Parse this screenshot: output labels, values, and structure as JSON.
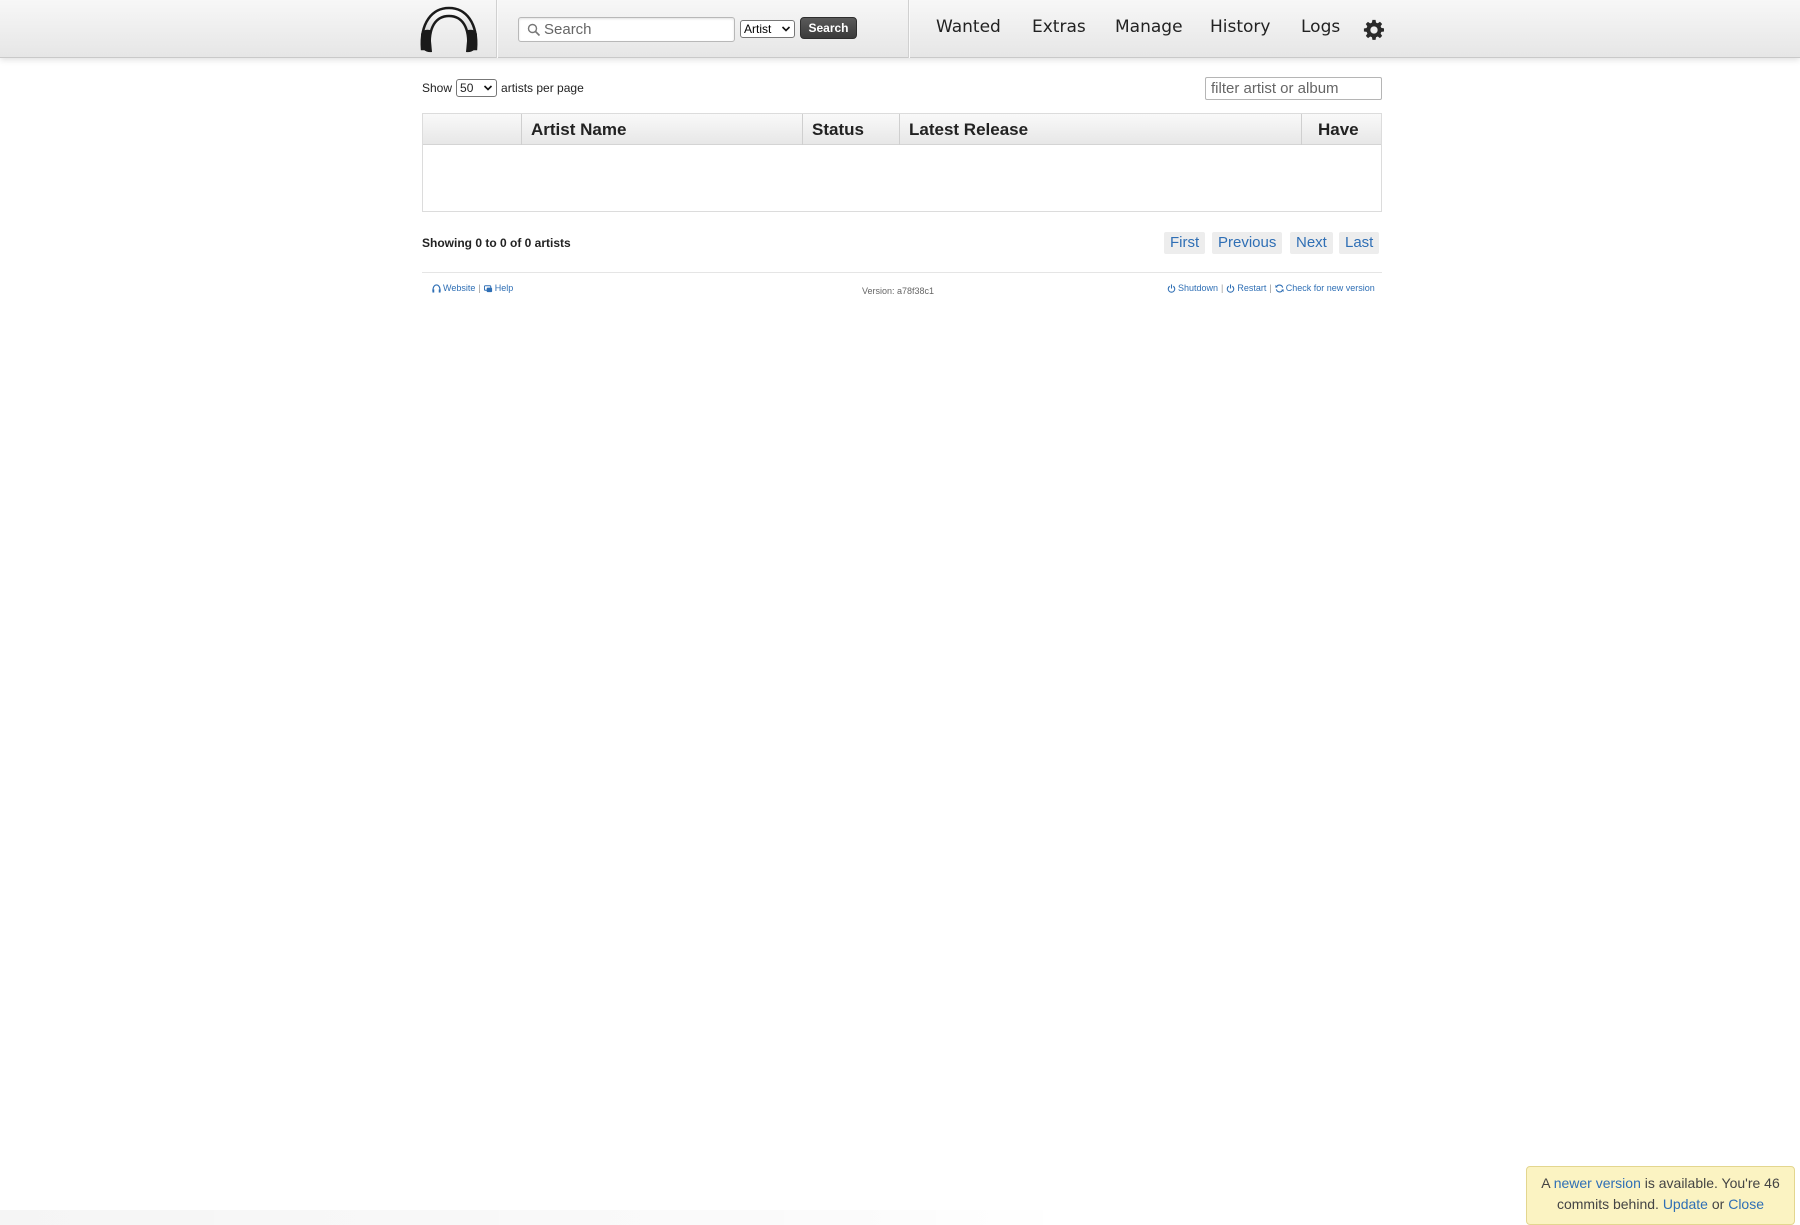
{
  "header": {
    "search": {
      "placeholder": "Search",
      "value": ""
    },
    "search_type": {
      "selected": "Artist"
    },
    "search_button_label": "Search",
    "nav": [
      "Wanted",
      "Extras",
      "Manage",
      "History",
      "Logs"
    ]
  },
  "controls": {
    "show_label": "Show",
    "per_page_value": "50",
    "per_page_suffix": "artists per page",
    "filter_placeholder": "filter artist or album"
  },
  "table": {
    "columns": [
      "",
      "Artist Name",
      "Status",
      "Latest Release",
      "Have"
    ],
    "rows": []
  },
  "pagination": {
    "info": "Showing 0 to 0 of 0 artists",
    "buttons": [
      "First",
      "Previous",
      "Next",
      "Last"
    ]
  },
  "footer": {
    "website": "Website",
    "help": "Help",
    "version": "Version: a78f38c1",
    "shutdown": "Shutdown",
    "restart": "Restart",
    "check": "Check for new version"
  },
  "notice": {
    "prefix": "A",
    "link": "newer version",
    "mid": "is available. You're 46 commits behind.",
    "update": "Update",
    "or": "or",
    "close": "Close"
  },
  "colors": {
    "link": "#2f6fb5",
    "notice_bg": "#fbf3c2",
    "search_button": "#444444"
  }
}
